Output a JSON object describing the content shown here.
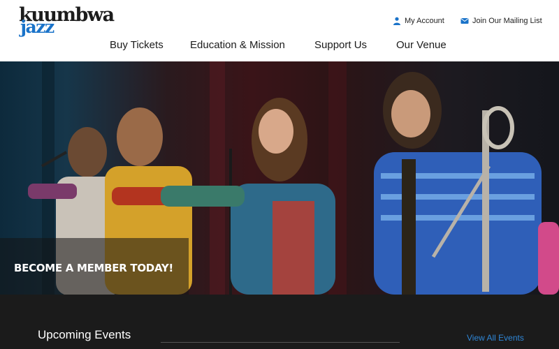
{
  "brand": {
    "logo_line1": "kuumbwa",
    "logo_line2": "jazz",
    "accent_color": "#1a73c9"
  },
  "utility_nav": {
    "account_label": "My Account",
    "account_icon": "person-icon",
    "mailing_label": "Join Our Mailing List",
    "mailing_icon": "envelope-icon"
  },
  "main_nav": {
    "items": [
      {
        "label": "Buy Tickets"
      },
      {
        "label": "Education & Mission"
      },
      {
        "label": "Support Us"
      },
      {
        "label": "Our Venue"
      }
    ]
  },
  "hero": {
    "cta_label": "BECOME A MEMBER TODAY!"
  },
  "events": {
    "heading": "Upcoming Events",
    "view_all_label": "View All Events",
    "link_color": "#2f86d6"
  }
}
